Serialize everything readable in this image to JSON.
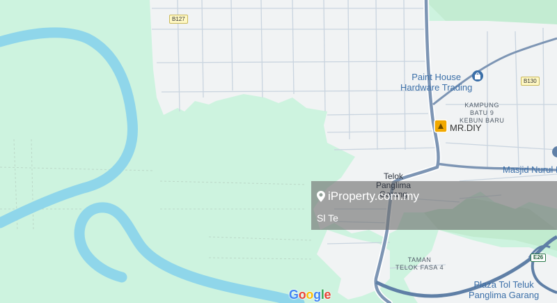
{
  "map": {
    "roads": {
      "b127": "B127",
      "b130": "B130",
      "e26": "E26"
    },
    "pois": {
      "paint_house_line1": "Paint House",
      "paint_house_line2": "Hardware Trading",
      "mr_diy": "MR.DIY",
      "masjid": "Masjid Nurul I",
      "plaza_line1": "Plaza Tol Teluk",
      "plaza_line2": "Panglima Garang"
    },
    "areas": {
      "kampung_line1": "KAMPUNG",
      "kampung_line2": "BATU 9",
      "kampung_line3": "KEBUN BARU",
      "taman_line1": "TAMAN",
      "taman_line2": "TELOK FASA 4"
    },
    "town": {
      "line1": "Telok",
      "line2": "Panglima",
      "line3": "Garang"
    },
    "watermark": "iProperty.com.my",
    "partial_text": "Sl Te",
    "attribution": "Google"
  },
  "colors": {
    "land": "#cdf3df",
    "urban": "#f1f3f4",
    "river": "#8fd6ea",
    "major_road": "#7d95b4",
    "minor_road": "#c9d4df",
    "highway": "#5f7fa6"
  }
}
